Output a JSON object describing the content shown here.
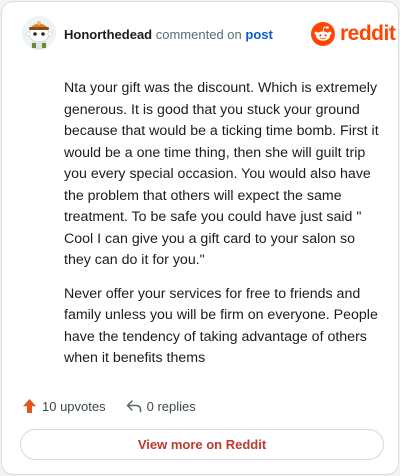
{
  "comment": {
    "author": "Honorthedead",
    "action_text": "commented on",
    "post_link": "post",
    "paragraphs": [
      "Nta your gift was the discount. Which is extremely generous. It is good that you stuck your ground because that would be a ticking time bomb. First it would be a one time thing, then she will guilt trip you every special occasion. You would also have the problem that others will expect the same treatment. To be safe you could have just said \" Cool I can give you a gift card to your salon so they can do it for you.\"",
      "Never offer your services for free to friends and family unless you will be firm on everyone. People have the tendency of taking advantage of others when it benefits thems"
    ],
    "upvotes": "10 upvotes",
    "replies": "0 replies"
  },
  "brand": {
    "name": "reddit",
    "color": "#ff4500"
  },
  "icons": {
    "avatar": "snoo-avatar-icon",
    "upvote": "upvote-arrow-icon",
    "reply": "reply-arrow-icon",
    "logo": "reddit-alien-icon"
  },
  "actions": {
    "view_more": "View more on Reddit"
  },
  "colors": {
    "username": "#1c1c1c",
    "meta": "#576f76",
    "link": "#0b5ccb",
    "upvote": "#e8511a",
    "button_text": "#c0392b"
  }
}
